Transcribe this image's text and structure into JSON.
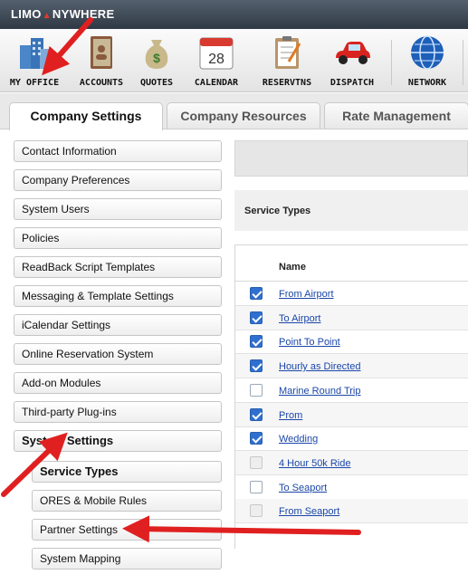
{
  "app": {
    "logo_left": "LIMO",
    "logo_right": "NYWHERE"
  },
  "nav": {
    "items": [
      {
        "label": "MY OFFICE",
        "icon": "office-building-icon"
      },
      {
        "label": "ACCOUNTS",
        "icon": "address-book-icon"
      },
      {
        "label": "QUOTES",
        "icon": "money-bag-icon"
      },
      {
        "label": "CALENDAR",
        "icon": "calendar-icon",
        "day": "28"
      },
      {
        "label": "RESERVTNS",
        "icon": "clipboard-icon"
      },
      {
        "label": "DISPATCH",
        "icon": "red-car-icon"
      },
      {
        "label": "NETWORK",
        "icon": "globe-icon"
      }
    ]
  },
  "tabs": [
    {
      "label": "Company Settings",
      "active": true
    },
    {
      "label": "Company Resources",
      "active": false
    },
    {
      "label": "Rate Management",
      "active": false
    }
  ],
  "sidebar": {
    "items": [
      {
        "label": "Contact Information"
      },
      {
        "label": "Company Preferences"
      },
      {
        "label": "System Users"
      },
      {
        "label": "Policies"
      },
      {
        "label": "ReadBack Script Templates"
      },
      {
        "label": "Messaging & Template Settings"
      },
      {
        "label": "iCalendar Settings"
      },
      {
        "label": "Online Reservation System"
      },
      {
        "label": "Add-on Modules"
      },
      {
        "label": "Third-party Plug-ins"
      },
      {
        "label": "System Settings"
      }
    ],
    "subitems": [
      {
        "label": "Service Types"
      },
      {
        "label": "ORES & Mobile Rules"
      },
      {
        "label": "Partner Settings"
      },
      {
        "label": "System Mapping"
      }
    ]
  },
  "main": {
    "section_title": "Service Types",
    "column_name": "Name",
    "rows": [
      {
        "name": "From Airport",
        "checked": true
      },
      {
        "name": "To Airport",
        "checked": true
      },
      {
        "name": "Point To Point",
        "checked": true
      },
      {
        "name": "Hourly as Directed",
        "checked": true
      },
      {
        "name": "Marine Round Trip",
        "checked": false
      },
      {
        "name": "Prom",
        "checked": true
      },
      {
        "name": "Wedding",
        "checked": true
      },
      {
        "name": "4 Hour 50k Ride",
        "checked": false,
        "disabled": true
      },
      {
        "name": "To Seaport",
        "checked": false
      },
      {
        "name": "From Seaport",
        "checked": false,
        "disabled": true
      }
    ]
  },
  "colors": {
    "accent": "#2f6fcf",
    "arrow": "#e02020",
    "link": "#1b47a8"
  }
}
